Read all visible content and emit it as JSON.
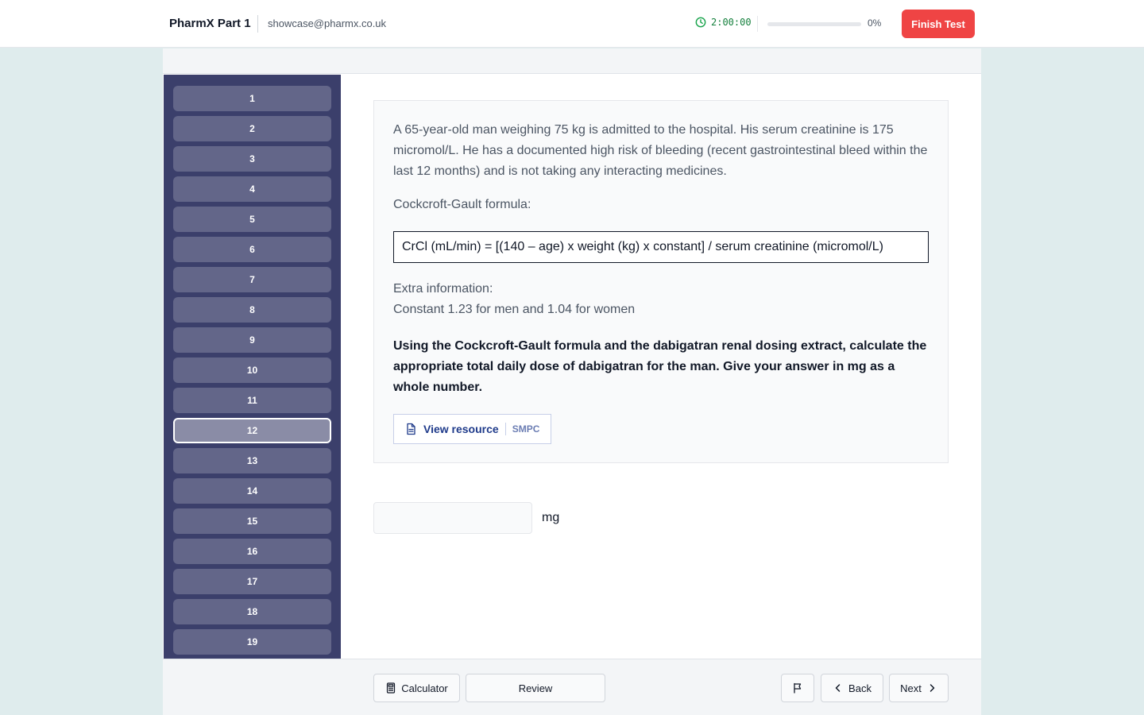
{
  "header": {
    "brand": "PharmX Part 1",
    "email": "showcase@pharmx.co.uk",
    "timer": "2:00:00",
    "timer_icon": "clock-icon",
    "progress_percent": 0,
    "progress_label": "0%",
    "finish_label": "Finish Test",
    "accent_color": "#ef4444",
    "timer_color": "#15803d"
  },
  "sidebar": {
    "active": "12",
    "questions": [
      "1",
      "2",
      "3",
      "4",
      "5",
      "6",
      "7",
      "8",
      "9",
      "10",
      "11",
      "12",
      "13",
      "14",
      "15",
      "16",
      "17",
      "18",
      "19"
    ],
    "background_color": "#3b3f6b",
    "button_color": "#636689"
  },
  "question": {
    "stem": "A 65-year-old man weighing 75 kg is admitted to the hospital. His serum creatinine is 175 micromol/L. He has a documented high risk of bleeding (recent gastrointestinal bleed within the last 12 months) and is not taking any interacting medicines.",
    "formula_label": "Cockcroft-Gault formula:",
    "formula": "CrCl (mL/min) = [(140 – age) x weight (kg) x constant] / serum creatinine (micromol/L)",
    "extra_heading": "Extra information:",
    "extra_text": "Constant 1.23 for men and 1.04 for women",
    "prompt": "Using the Cockcroft-Gault formula and the dabigatran renal dosing extract, calculate the appropriate total daily dose of dabigatran for the man. Give your answer in mg as a whole number.",
    "resource_label": "View resource",
    "resource_tag": "SMPC",
    "resource_icon": "document-icon"
  },
  "answer": {
    "value": "",
    "placeholder": "",
    "unit": "mg"
  },
  "footer": {
    "calculator_label": "Calculator",
    "calculator_icon": "calculator-icon",
    "review_label": "Review",
    "flag_icon": "flag-icon",
    "back_label": "Back",
    "next_label": "Next"
  }
}
